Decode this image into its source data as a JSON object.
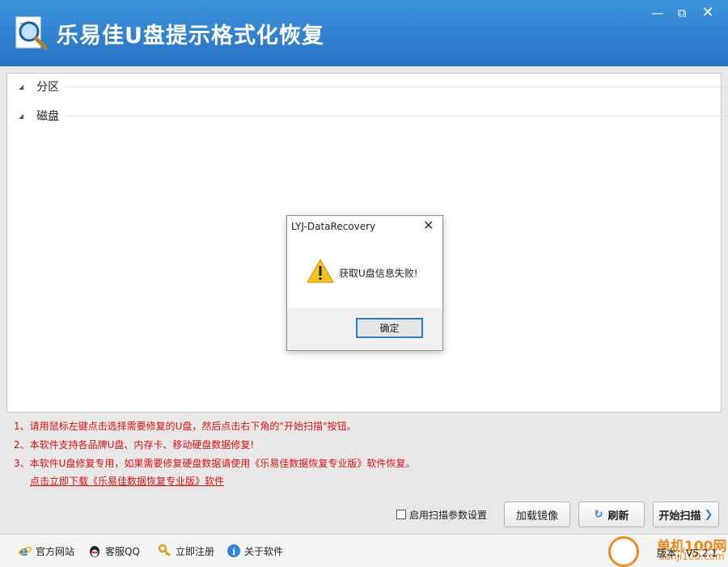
{
  "app": {
    "title": "乐易佳U盘提示格式化恢复"
  },
  "window_controls": {
    "minimize": "—",
    "maximize": "⧉",
    "close": "✕"
  },
  "tree": {
    "groups": [
      {
        "label": "分区"
      },
      {
        "label": "磁盘"
      }
    ]
  },
  "notes": {
    "line1": "1、请用鼠标左键点击选择需要修复的U盘，然后点击右下角的\"开始扫描\"按钮。",
    "line2": "2、本软件支持各品牌U盘、内存卡、移动硬盘数据修复!",
    "line3": "3、本软件U盘修复专用，如果需要修复硬盘数据请使用《乐易佳数据恢复专业版》软件恢复。",
    "download_link": "点击立即下载《乐易佳数据恢复专业版》软件"
  },
  "controls": {
    "scan_settings_label": "启用扫描参数设置",
    "scan_settings_checked": false,
    "load_image": "加载镜像",
    "refresh": "刷新",
    "start_scan": "开始扫描"
  },
  "footer": {
    "website": "官方网站",
    "support_qq": "客服QQ",
    "register": "立即注册",
    "about": "关于软件",
    "version": "版本：V5.2.1"
  },
  "watermark": {
    "name": "单机100网",
    "url": "danji100.com"
  },
  "dialog": {
    "title": "LYJ-DataRecovery",
    "message": "获取U盘信息失败!",
    "ok": "确定",
    "icon": "warning-icon"
  },
  "colors": {
    "titlebar": "#2f7fcf",
    "notes": "#e01010",
    "accent": "#2f86d9"
  }
}
